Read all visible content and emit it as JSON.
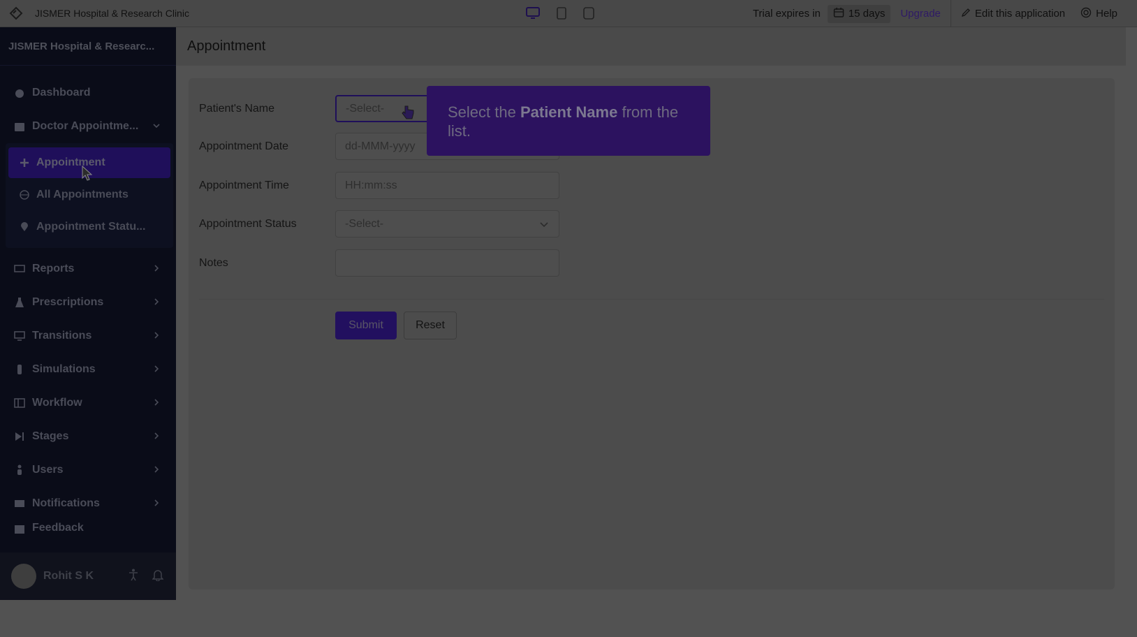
{
  "topbar": {
    "app_name": "JISMER Hospital & Research Clinic",
    "trial_label": "Trial expires in",
    "trial_days": "15 days",
    "upgrade_label": "Upgrade",
    "edit_label": "Edit this application",
    "help_label": "Help"
  },
  "sidebar": {
    "brand": "JISMER Hospital & Researc...",
    "dashboard": "Dashboard",
    "doctor_group": "Doctor Appointme...",
    "sub_items": [
      "Appointment",
      "All Appointments",
      "Appointment Statu..."
    ],
    "items": [
      "Reports",
      "Prescriptions",
      "Transitions",
      "Simulations",
      "Workflow",
      "Stages",
      "Users",
      "Notifications",
      "Feedback"
    ],
    "user_name": "Rohit S K"
  },
  "main": {
    "title": "Appointment",
    "fields": {
      "patient_label": "Patient's Name",
      "patient_placeholder": "-Select-",
      "date_label": "Appointment Date",
      "date_placeholder": "dd-MMM-yyyy",
      "time_label": "Appointment Time",
      "time_placeholder": "HH:mm:ss",
      "status_label": "Appointment Status",
      "status_placeholder": "-Select-",
      "notes_label": "Notes"
    },
    "submit_label": "Submit",
    "reset_label": "Reset"
  },
  "tooltip": {
    "prefix": "Select the ",
    "bold": "Patient Name",
    "suffix": " from the list."
  },
  "colors": {
    "accent": "#22105f",
    "sidebar_bg": "#0a0c18",
    "overlay_bg": "#525252"
  }
}
